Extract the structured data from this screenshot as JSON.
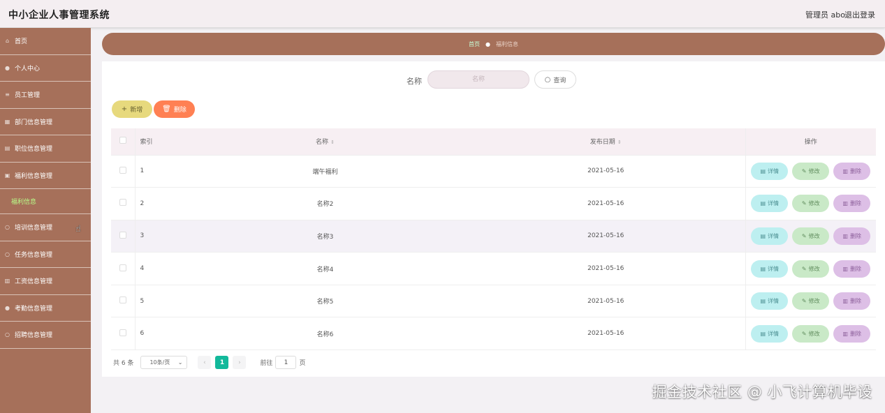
{
  "header": {
    "title": "中小企业人事管理系统",
    "user_label": "管理员 abo",
    "logout_label": "退出登录"
  },
  "sidebar": {
    "items": [
      {
        "label": "首页",
        "icon": "home-icon"
      },
      {
        "label": "个人中心",
        "icon": "user-icon"
      },
      {
        "label": "员工管理",
        "icon": "list-icon"
      },
      {
        "label": "部门信息管理",
        "icon": "grid-icon"
      },
      {
        "label": "职位信息管理",
        "icon": "doc-icon"
      },
      {
        "label": "福利信息管理",
        "icon": "gift-icon"
      },
      {
        "label": "培训信息管理",
        "icon": "circle-icon"
      },
      {
        "label": "任务信息管理",
        "icon": "task-icon"
      },
      {
        "label": "工资信息管理",
        "icon": "chart-icon"
      },
      {
        "label": "考勤信息管理",
        "icon": "user-icon"
      },
      {
        "label": "招聘信息管理",
        "icon": "circle-icon"
      }
    ],
    "active_submenu": "福利信息"
  },
  "breadcrumb": {
    "home": "首页",
    "separator": "●",
    "current": "福利信息"
  },
  "search": {
    "label": "名称",
    "placeholder": "名称",
    "button_label": "查询"
  },
  "actions": {
    "add_label": "新增",
    "delete_label": "删除"
  },
  "table": {
    "headers": {
      "index": "索引",
      "name": "名称",
      "date": "发布日期",
      "ops": "操作"
    },
    "rows": [
      {
        "index": "1",
        "name": "端午福利",
        "date": "2021-05-16"
      },
      {
        "index": "2",
        "name": "名称2",
        "date": "2021-05-16"
      },
      {
        "index": "3",
        "name": "名称3",
        "date": "2021-05-16"
      },
      {
        "index": "4",
        "name": "名称4",
        "date": "2021-05-16"
      },
      {
        "index": "5",
        "name": "名称5",
        "date": "2021-05-16"
      },
      {
        "index": "6",
        "name": "名称6",
        "date": "2021-05-16"
      }
    ],
    "row_actions": {
      "view": "详情",
      "edit": "修改",
      "delete": "删除"
    }
  },
  "pagination": {
    "total": "共 6 条",
    "page_size": "10条/页",
    "current_page": "1",
    "goto_label": "前往",
    "goto_value": "1",
    "page_unit": "页"
  },
  "watermark": "掘金技术社区 @ 小飞计算机毕设",
  "colors": {
    "sidebar": "#a6705a",
    "accent": "#13b99b",
    "add_button": "#e7d97d",
    "delete_button": "#ff8053"
  }
}
